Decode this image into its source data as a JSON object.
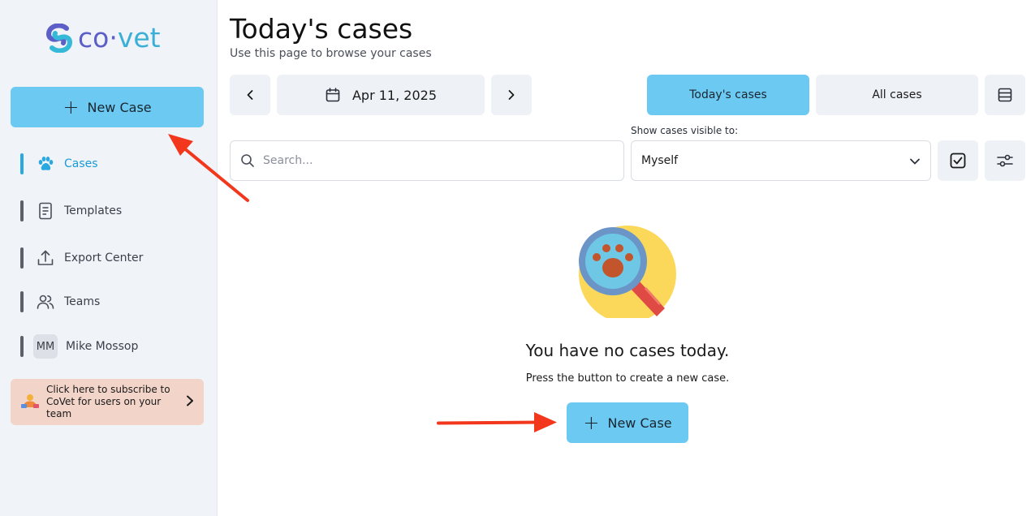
{
  "brand": {
    "name_prefix": "co",
    "name_dot": "·",
    "name_suffix": "vet"
  },
  "sidebar": {
    "new_case_label": "New Case",
    "items": [
      {
        "label": "Cases",
        "icon": "paw-icon",
        "active": true
      },
      {
        "label": "Templates",
        "icon": "document-icon",
        "active": false
      },
      {
        "label": "Export Center",
        "icon": "upload-icon",
        "active": false
      },
      {
        "label": "Teams",
        "icon": "users-icon",
        "active": false
      }
    ],
    "user": {
      "initials": "MM",
      "name": "Mike Mossop"
    },
    "promo": {
      "text": "Click here to subscribe to CoVet for users on your team"
    }
  },
  "header": {
    "title": "Today's cases",
    "subtitle": "Use this page to browse your cases"
  },
  "toolbar": {
    "date": "Apr 11, 2025",
    "todays_cases_label": "Today's cases",
    "all_cases_label": "All cases",
    "search_placeholder": "Search...",
    "visibility_label": "Show cases visible to:",
    "visibility_value": "Myself"
  },
  "empty_state": {
    "title": "You have no cases today.",
    "subtitle": "Press the button to create a new case.",
    "button_label": "New Case"
  },
  "colors": {
    "accent": "#6ccaf2",
    "annotation_arrow": "#f2371c"
  }
}
